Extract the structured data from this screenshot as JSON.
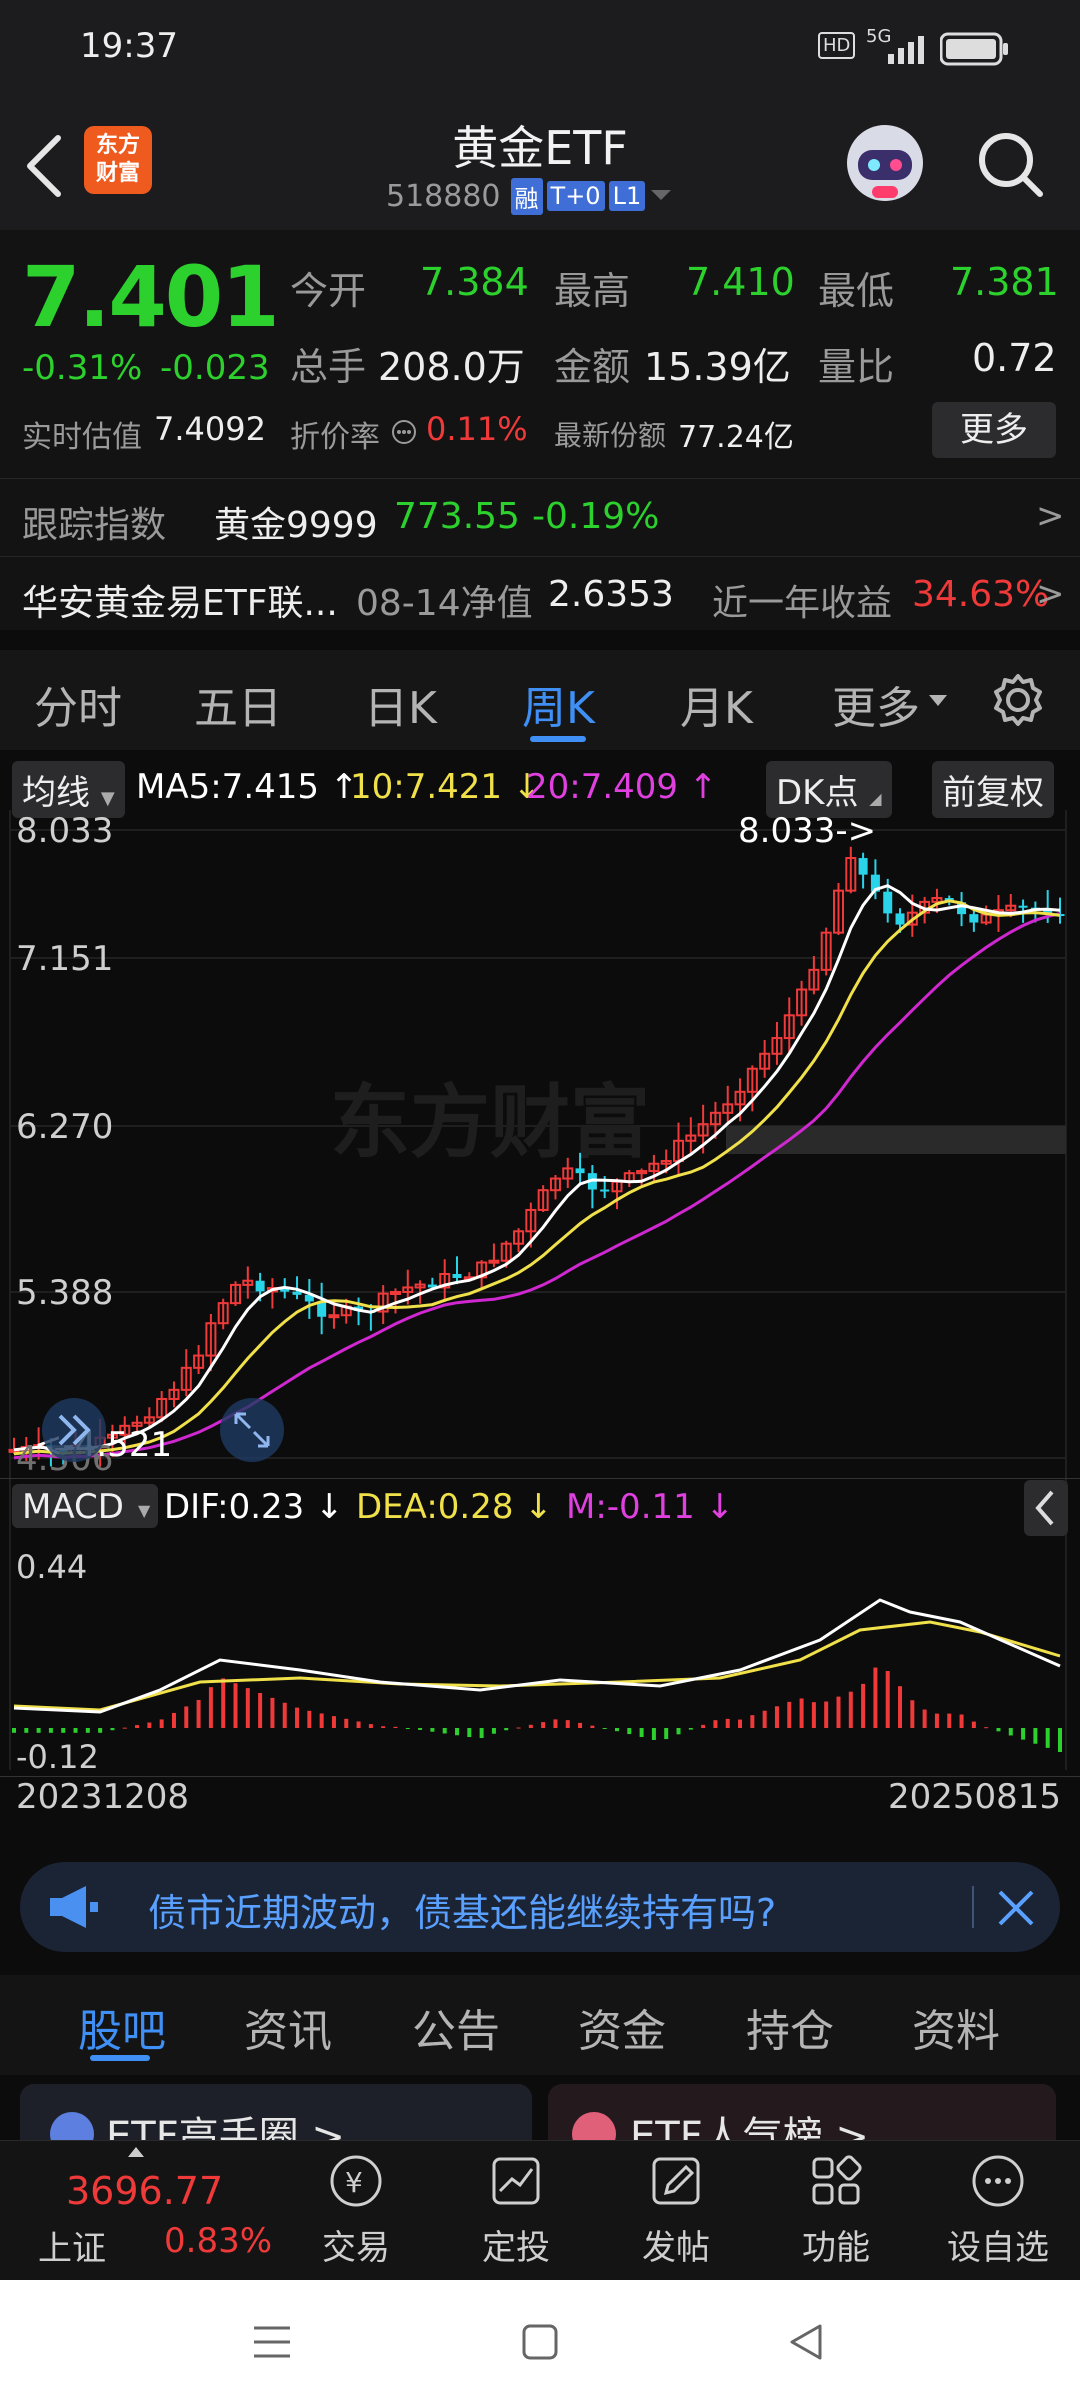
{
  "status_bar": {
    "time": "19:37",
    "hd": "HD",
    "network": "5G"
  },
  "header": {
    "logo_text": "东方\n财富",
    "title": "黄金ETF",
    "code": "518880",
    "badges": [
      "融",
      "T+0",
      "L1"
    ]
  },
  "quote": {
    "price": "7.401",
    "change_pct": "-0.31%",
    "change_abs": "-0.023",
    "open_label": "今开",
    "open": "7.384",
    "high_label": "最高",
    "high": "7.410",
    "low_label": "最低",
    "low": "7.381",
    "volume_label": "总手",
    "volume": "208.0万",
    "amount_label": "金额",
    "amount": "15.39亿",
    "ratio_label": "量比",
    "ratio": "0.72",
    "iopv_label": "实时估值",
    "iopv": "7.4092",
    "discount_label": "折价率",
    "discount": "0.11%",
    "shares_label": "最新份额",
    "shares": "77.24亿",
    "more_btn": "更多"
  },
  "tracking": {
    "label": "跟踪指数",
    "name": "黄金9999",
    "value": "773.55",
    "change": "-0.19%",
    "arrow": ">"
  },
  "fund": {
    "name": "华安黄金易ETF联...",
    "nav_label": "08-14净值",
    "nav": "2.6353",
    "return_label": "近一年收益",
    "return": "34.63%",
    "arrow": ">"
  },
  "period_tabs": [
    "分时",
    "五日",
    "日K",
    "周K",
    "月K",
    "更多"
  ],
  "active_period": "周K",
  "ma_bar": {
    "selector": "均线",
    "ma5": "MA5:7.415 ↑",
    "ma10": "10:7.421 ↓",
    "ma20": "20:7.409 ↑",
    "dk_btn": "DK点",
    "adj_btn": "前复权"
  },
  "price_axis": [
    "8.033",
    "7.151",
    "6.270",
    "5.388",
    "4.506"
  ],
  "annotations": {
    "high": "8.033->",
    "low": "<-4.521"
  },
  "watermark": "东方财富",
  "macd_bar": {
    "selector": "MACD",
    "dif": "DIF:0.23 ↓",
    "dea": "DEA:0.28 ↓",
    "m": "M:-0.11 ↓"
  },
  "macd_axis": [
    "0.44",
    "-0.12"
  ],
  "date_range": {
    "start": "20231208",
    "end": "20250815"
  },
  "banner": {
    "text": "债市近期波动，债基还能继续持有吗?"
  },
  "section_tabs": [
    "股吧",
    "资讯",
    "公告",
    "资金",
    "持仓",
    "资料"
  ],
  "active_section": "股吧",
  "cards": [
    "ETF高手圈 >",
    "ETF人气榜 >"
  ],
  "bottom_nav": {
    "index_value": "3696.77",
    "index_name": "上证",
    "index_change": "0.83%",
    "items": [
      "交易",
      "定投",
      "发帖",
      "功能",
      "设自选"
    ]
  },
  "colors": {
    "up": "#f03a3a",
    "down": "#2dd12d",
    "accent": "#3f8ff5",
    "ma5": "#ffffff",
    "ma10": "#f0e04a",
    "ma20": "#d028d0",
    "candle_down": "#2ad4e8"
  }
}
